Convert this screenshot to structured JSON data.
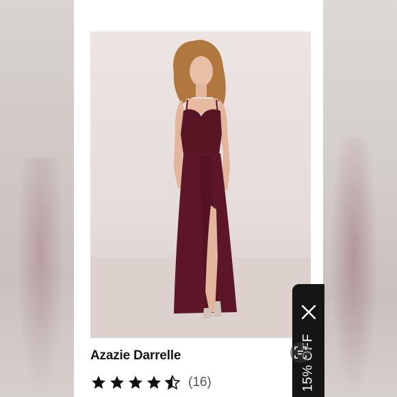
{
  "product": {
    "name": "Azazie Darrelle",
    "rating": 4.5,
    "rating_max": 5,
    "review_count": "(16)",
    "dress_color": "#5a1525"
  },
  "promo": {
    "label": "15% OFF",
    "background": "#151515"
  },
  "icons": {
    "close": "close-icon",
    "lens": "visual-search-icon",
    "star_full": "star-full-icon",
    "star_half": "star-half-icon"
  }
}
